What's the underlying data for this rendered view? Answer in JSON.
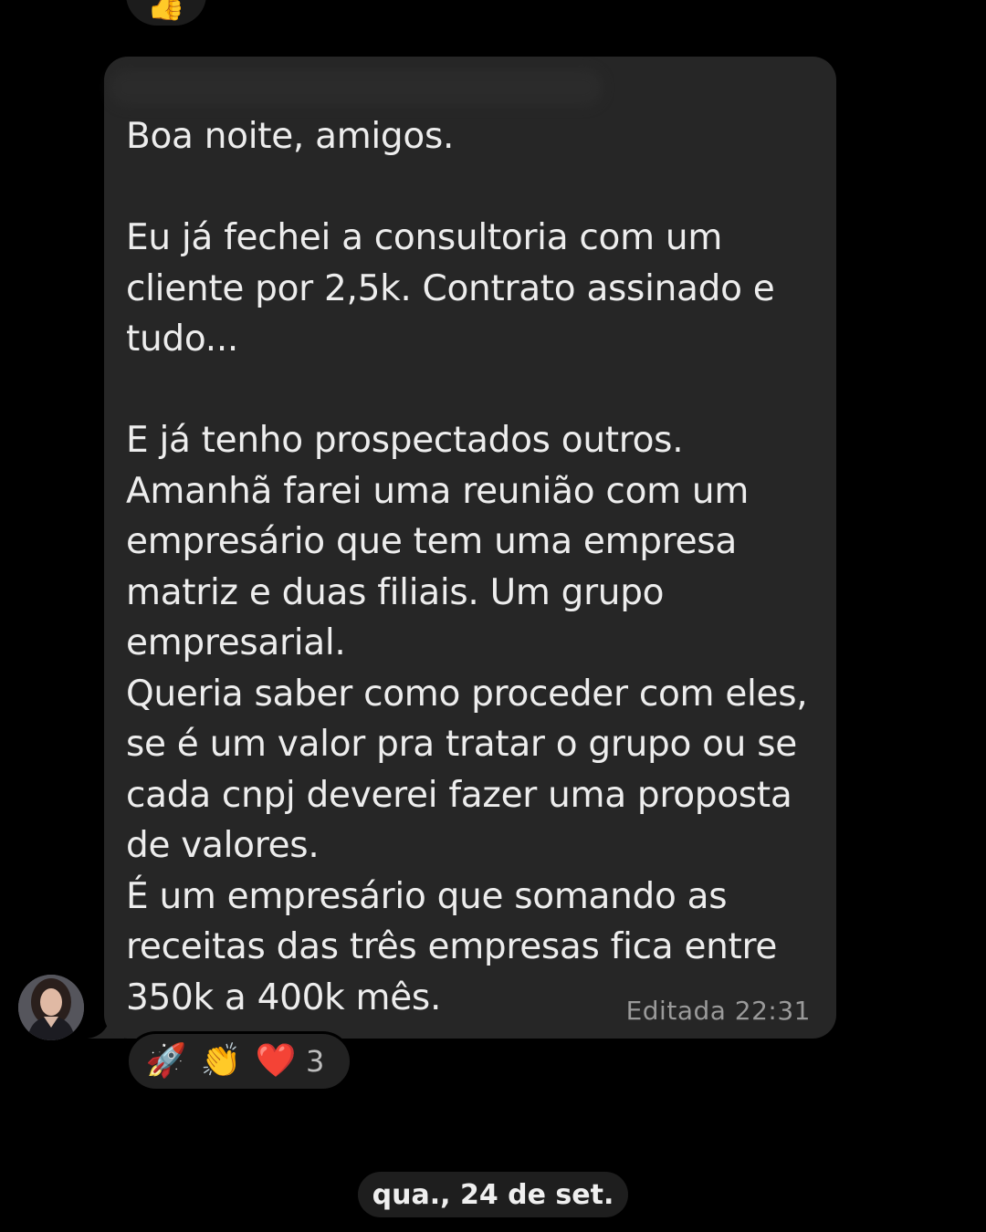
{
  "previous_message": {
    "reaction_icon": "thumbs-up-icon",
    "reaction_glyph": "👍"
  },
  "message": {
    "sender_name": "",
    "text": "Boa noite, amigos.\n\nEu já fechei a consultoria com um\ncliente por 2,5k. Contrato assinado e\ntudo...\n\nE já tenho prospectados outros.\nAmanhã farei uma reunião com um\nempresário que tem uma empresa\nmatriz e duas filiais. Um grupo\nempresarial.\nQueria saber como proceder com eles,\nse é um valor pra tratar o grupo ou se\ncada cnpj deverei fazer uma proposta\nde valores.\nÉ um empresário que somando as\nreceitas das três empresas fica entre\n350k a 400k mês.",
    "edited_label": "Editada 22:31"
  },
  "reactions": {
    "items": [
      {
        "icon": "rocket-icon",
        "glyph": "🚀"
      },
      {
        "icon": "clapping-hands-icon",
        "glyph": "👏"
      },
      {
        "icon": "red-heart-icon",
        "glyph": "❤️"
      }
    ],
    "count": "3"
  },
  "date_separator": {
    "label": "qua., 24 de set."
  },
  "colors": {
    "background": "#000000",
    "bubble": "#262626",
    "text": "#ededed",
    "meta": "#9a9a9a"
  }
}
